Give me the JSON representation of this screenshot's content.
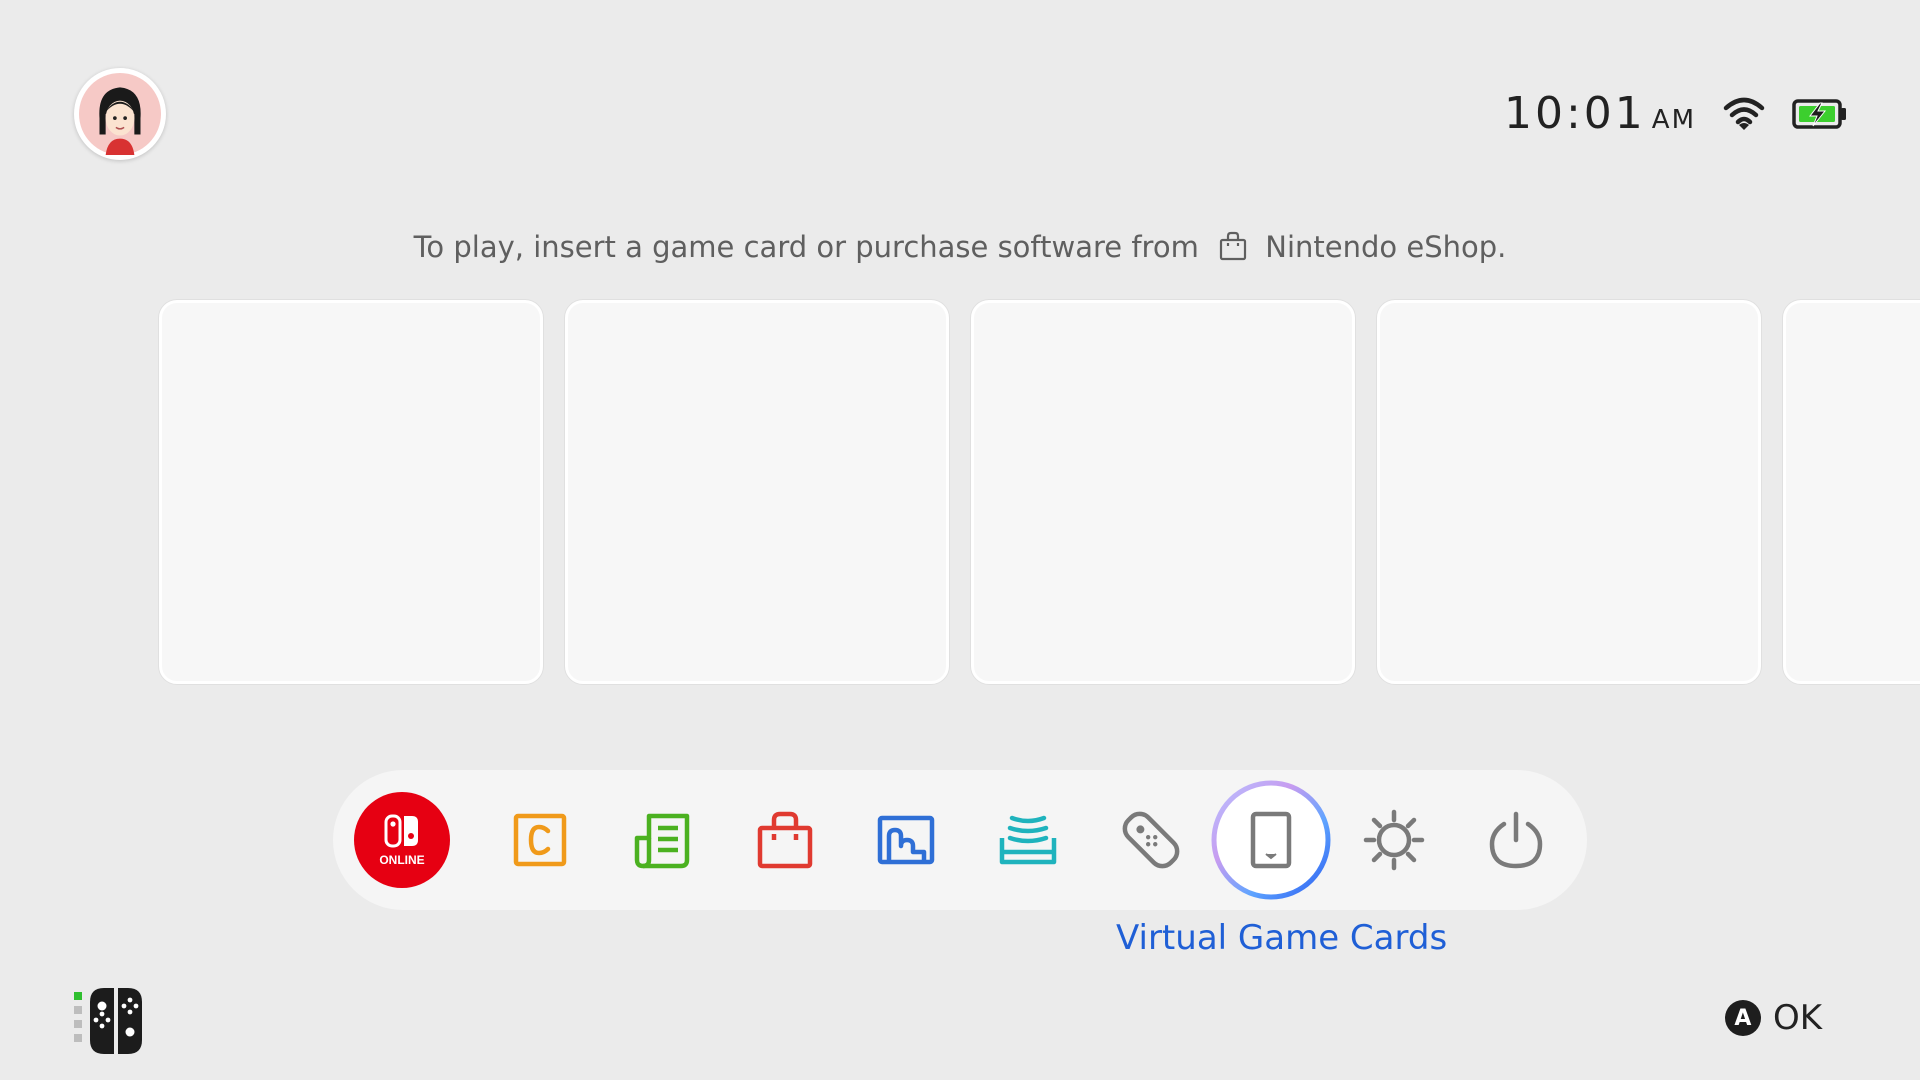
{
  "header": {
    "avatar_icon": "mii-avatar-icon",
    "clock_time": "10:01",
    "clock_ampm": "AM",
    "wifi_icon": "wifi-icon",
    "battery_icon": "battery-charging-icon"
  },
  "hint": {
    "text_before": "To play, insert a game card or purchase software from",
    "icon": "shopping-bag-icon",
    "text_after": "Nintendo eShop."
  },
  "tiles": {
    "count_visible": 5,
    "style": "empty-placeholder"
  },
  "dock": {
    "items": [
      {
        "name": "nintendo-switch-online",
        "icon": "switch-online-icon",
        "badge_text": "ONLINE",
        "color": "#e60012"
      },
      {
        "name": "gamechat",
        "icon": "c-square-icon",
        "color": "#f09a1a"
      },
      {
        "name": "news",
        "icon": "news-icon",
        "color": "#4bb120"
      },
      {
        "name": "nintendo-eshop",
        "icon": "shopping-bag-icon",
        "color": "#e03a30"
      },
      {
        "name": "album",
        "icon": "album-icon",
        "color": "#2f6fd6"
      },
      {
        "name": "game-share",
        "icon": "stack-icon",
        "color": "#1fb3bd"
      },
      {
        "name": "controllers",
        "icon": "controller-icon",
        "color": "#7a7a7a"
      },
      {
        "name": "virtual-game-cards",
        "icon": "game-card-icon",
        "color": "#7a7a7a",
        "selected": true
      },
      {
        "name": "system-settings",
        "icon": "gear-icon",
        "color": "#7a7a7a"
      },
      {
        "name": "power",
        "icon": "power-icon",
        "color": "#7a7a7a"
      }
    ],
    "selected_label": "Virtual Game Cards",
    "label_color": "#1f5fd6"
  },
  "footer": {
    "controller_icon": "joy-con-icon",
    "button_glyph": "A",
    "action_label": "OK"
  }
}
